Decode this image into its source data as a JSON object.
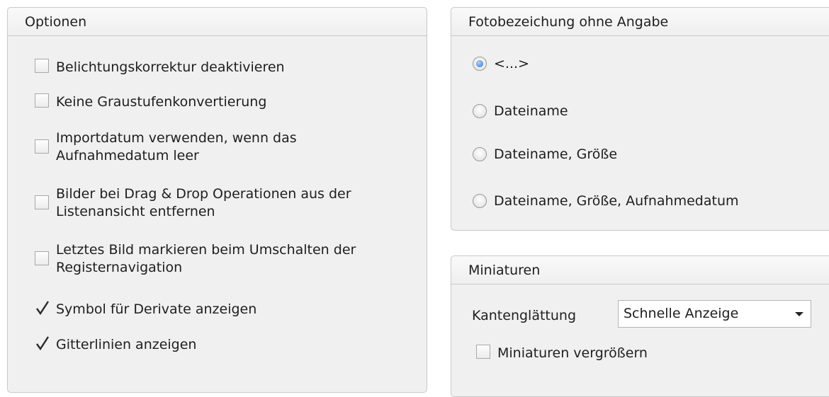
{
  "options": {
    "title": "Optionen",
    "items": [
      {
        "lines": [
          "Belichtungskorrektur deaktivieren"
        ],
        "checked": false
      },
      {
        "lines": [
          "Keine Graustufenkonvertierung"
        ],
        "checked": false
      },
      {
        "lines": [
          "Importdatum verwenden, wenn das",
          "Aufnahmedatum leer"
        ],
        "checked": false
      },
      {
        "lines": [
          "Bilder bei Drag & Drop Operationen aus der",
          "Listenansicht entfernen"
        ],
        "checked": false
      },
      {
        "lines": [
          "Letztes Bild markieren beim Umschalten der",
          "Registernavigation"
        ],
        "checked": false
      },
      {
        "lines": [
          "Symbol für Derivate anzeigen"
        ],
        "checked": true
      },
      {
        "lines": [
          "Gitterlinien anzeigen"
        ],
        "checked": true
      }
    ]
  },
  "photo_label": {
    "title": "Fotobezeichung ohne Angabe",
    "choices": [
      {
        "label": "<...>",
        "selected": true
      },
      {
        "label": "Dateiname",
        "selected": false
      },
      {
        "label": "Dateiname, Größe",
        "selected": false
      },
      {
        "label": "Dateiname, Größe, Aufnahmedatum",
        "selected": false
      }
    ]
  },
  "thumbnails": {
    "title": "Miniaturen",
    "antialias_label": "Kantenglättung",
    "antialias_value": "Schnelle Anzeige",
    "enlarge_label": "Miniaturen vergrößern",
    "enlarge_checked": false
  }
}
